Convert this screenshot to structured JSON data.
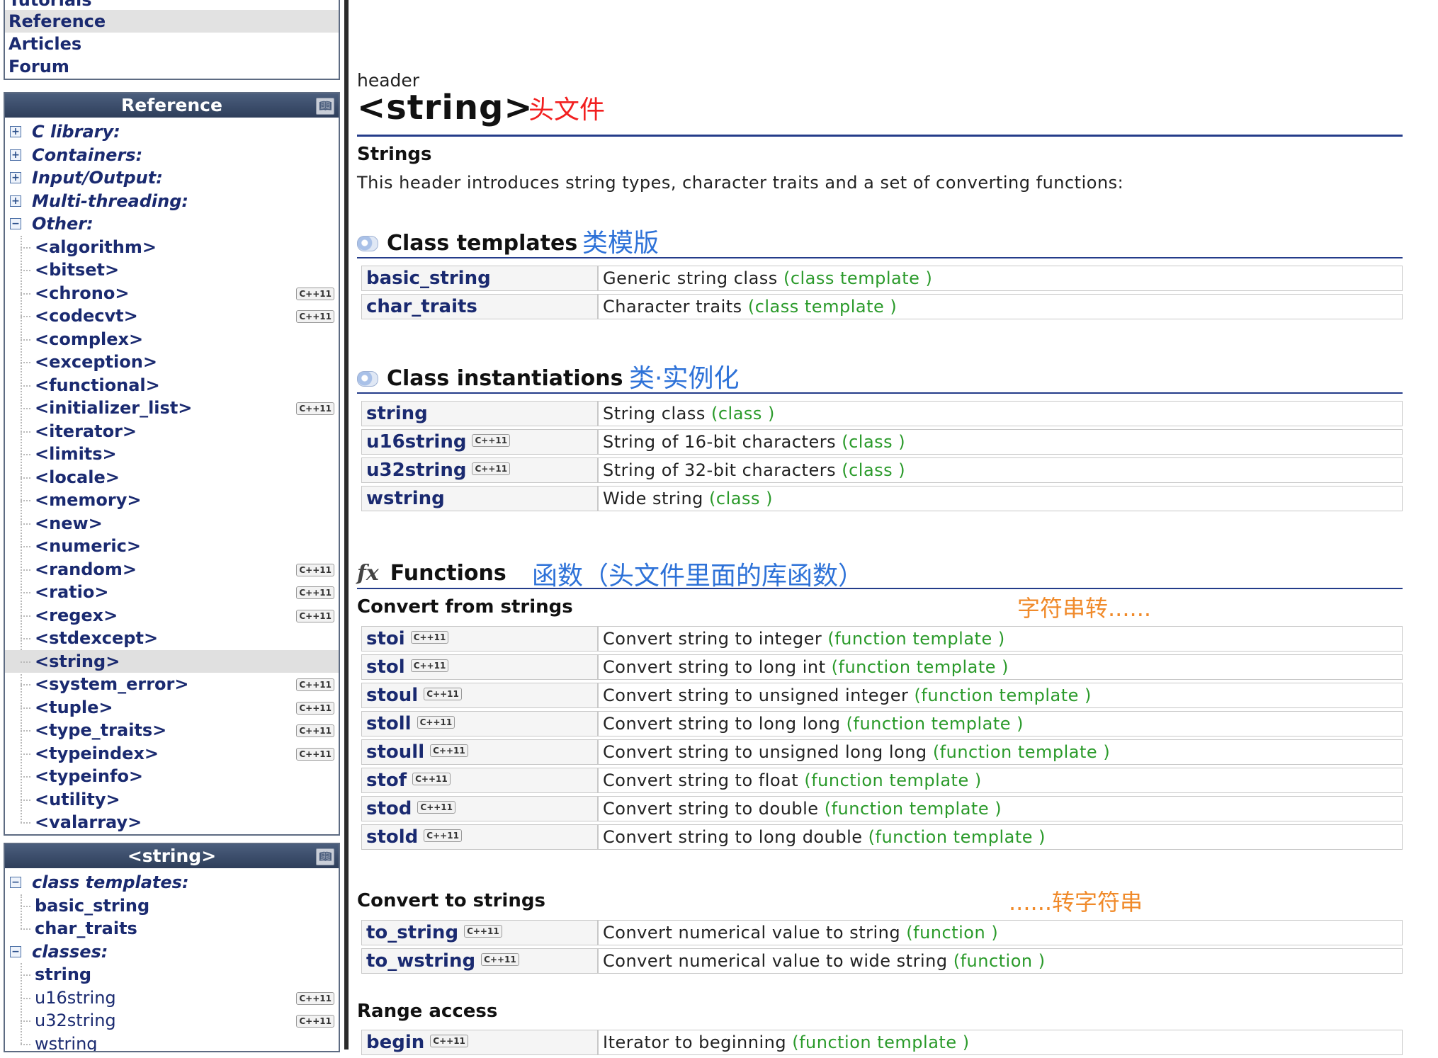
{
  "site_nav": {
    "items": [
      {
        "label": "Tutorials",
        "active": false,
        "partial": true
      },
      {
        "label": "Reference",
        "active": true,
        "partial": false
      },
      {
        "label": "Articles",
        "active": false,
        "partial": false
      },
      {
        "label": "Forum",
        "active": false,
        "partial": false
      }
    ]
  },
  "reference_panel": {
    "title": "Reference",
    "categories": [
      {
        "label": "C library:",
        "expander": "+"
      },
      {
        "label": "Containers:",
        "expander": "+"
      },
      {
        "label": "Input/Output:",
        "expander": "+"
      },
      {
        "label": "Multi-threading:",
        "expander": "+"
      },
      {
        "label": "Other:",
        "expander": "−"
      }
    ],
    "items": [
      {
        "label": "<algorithm>",
        "cpp11": false
      },
      {
        "label": "<bitset>",
        "cpp11": false
      },
      {
        "label": "<chrono>",
        "cpp11": true
      },
      {
        "label": "<codecvt>",
        "cpp11": true
      },
      {
        "label": "<complex>",
        "cpp11": false
      },
      {
        "label": "<exception>",
        "cpp11": false
      },
      {
        "label": "<functional>",
        "cpp11": false
      },
      {
        "label": "<initializer_list>",
        "cpp11": true
      },
      {
        "label": "<iterator>",
        "cpp11": false
      },
      {
        "label": "<limits>",
        "cpp11": false
      },
      {
        "label": "<locale>",
        "cpp11": false
      },
      {
        "label": "<memory>",
        "cpp11": false
      },
      {
        "label": "<new>",
        "cpp11": false
      },
      {
        "label": "<numeric>",
        "cpp11": false
      },
      {
        "label": "<random>",
        "cpp11": true
      },
      {
        "label": "<ratio>",
        "cpp11": true
      },
      {
        "label": "<regex>",
        "cpp11": true
      },
      {
        "label": "<stdexcept>",
        "cpp11": false
      },
      {
        "label": "<string>",
        "cpp11": false,
        "selected": true
      },
      {
        "label": "<system_error>",
        "cpp11": true
      },
      {
        "label": "<tuple>",
        "cpp11": true
      },
      {
        "label": "<type_traits>",
        "cpp11": true
      },
      {
        "label": "<typeindex>",
        "cpp11": true
      },
      {
        "label": "<typeinfo>",
        "cpp11": false
      },
      {
        "label": "<utility>",
        "cpp11": false
      },
      {
        "label": "<valarray>",
        "cpp11": false
      }
    ]
  },
  "string_panel": {
    "title": "<string>",
    "groups": [
      {
        "label": "class templates:",
        "items": [
          {
            "label": "basic_string",
            "cpp11": false,
            "bold": true
          },
          {
            "label": "char_traits",
            "cpp11": false,
            "bold": true
          }
        ]
      },
      {
        "label": "classes:",
        "items": [
          {
            "label": "string",
            "cpp11": false,
            "bold": true
          },
          {
            "label": "u16string",
            "cpp11": true,
            "bold": false
          },
          {
            "label": "u32string",
            "cpp11": true,
            "bold": false
          },
          {
            "label": "wstring",
            "cpp11": false,
            "bold": false
          }
        ]
      }
    ]
  },
  "cpp11_badge": "C++11",
  "header": {
    "kicker": "header",
    "title": "<string>",
    "annotation": "头文件"
  },
  "strings_section": {
    "title": "Strings",
    "description": "This header introduces string types, character traits and a set of converting functions:"
  },
  "class_templates": {
    "title": "Class templates",
    "annotation": "类模版",
    "rows": [
      {
        "name": "basic_string",
        "cpp11": false,
        "desc": "Generic string class",
        "kind": "(class template )"
      },
      {
        "name": "char_traits",
        "cpp11": false,
        "desc": "Character traits",
        "kind": "(class template )"
      }
    ]
  },
  "class_instantiations": {
    "title": "Class instantiations",
    "annotation": "类·实例化",
    "rows": [
      {
        "name": "string",
        "cpp11": false,
        "desc": "String class",
        "kind": "(class )"
      },
      {
        "name": "u16string",
        "cpp11": true,
        "desc": "String of 16-bit characters",
        "kind": "(class )"
      },
      {
        "name": "u32string",
        "cpp11": true,
        "desc": "String of 32-bit characters",
        "kind": "(class )"
      },
      {
        "name": "wstring",
        "cpp11": false,
        "desc": "Wide string",
        "kind": "(class )"
      }
    ]
  },
  "functions": {
    "icon": "fx",
    "title": "Functions",
    "annotation": "函数（头文件里面的库函数）",
    "convert_from": {
      "title": "Convert from strings",
      "annotation": "字符串转......",
      "rows": [
        {
          "name": "stoi",
          "cpp11": true,
          "desc": "Convert string to integer",
          "kind": "(function template )"
        },
        {
          "name": "stol",
          "cpp11": true,
          "desc": "Convert string to long int",
          "kind": "(function template )"
        },
        {
          "name": "stoul",
          "cpp11": true,
          "desc": "Convert string to unsigned integer",
          "kind": "(function template )"
        },
        {
          "name": "stoll",
          "cpp11": true,
          "desc": "Convert string to long long",
          "kind": "(function template )"
        },
        {
          "name": "stoull",
          "cpp11": true,
          "desc": "Convert string to unsigned long long",
          "kind": "(function template )"
        },
        {
          "name": "stof",
          "cpp11": true,
          "desc": "Convert string to float",
          "kind": "(function template )"
        },
        {
          "name": "stod",
          "cpp11": true,
          "desc": "Convert string to double",
          "kind": "(function template )"
        },
        {
          "name": "stold",
          "cpp11": true,
          "desc": "Convert string to long double",
          "kind": "(function template )"
        }
      ]
    },
    "convert_to": {
      "title": "Convert to strings",
      "annotation": "......转字符串",
      "rows": [
        {
          "name": "to_string",
          "cpp11": true,
          "desc": "Convert numerical value to string",
          "kind": "(function )"
        },
        {
          "name": "to_wstring",
          "cpp11": true,
          "desc": "Convert numerical value to wide string",
          "kind": "(function )"
        }
      ]
    },
    "range_access": {
      "title": "Range access",
      "rows": [
        {
          "name": "begin",
          "cpp11": true,
          "desc": "Iterator to beginning",
          "kind": "(function template )"
        }
      ]
    }
  },
  "colors": {
    "nav_text": "#1a2a70",
    "panel_header": "#3b4d6b",
    "rule": "#243c8a",
    "kind_green": "#2a9a2a",
    "annotation_red": "#f21f1f",
    "annotation_blue": "#2e72d8",
    "annotation_orange": "#f08a2a"
  }
}
